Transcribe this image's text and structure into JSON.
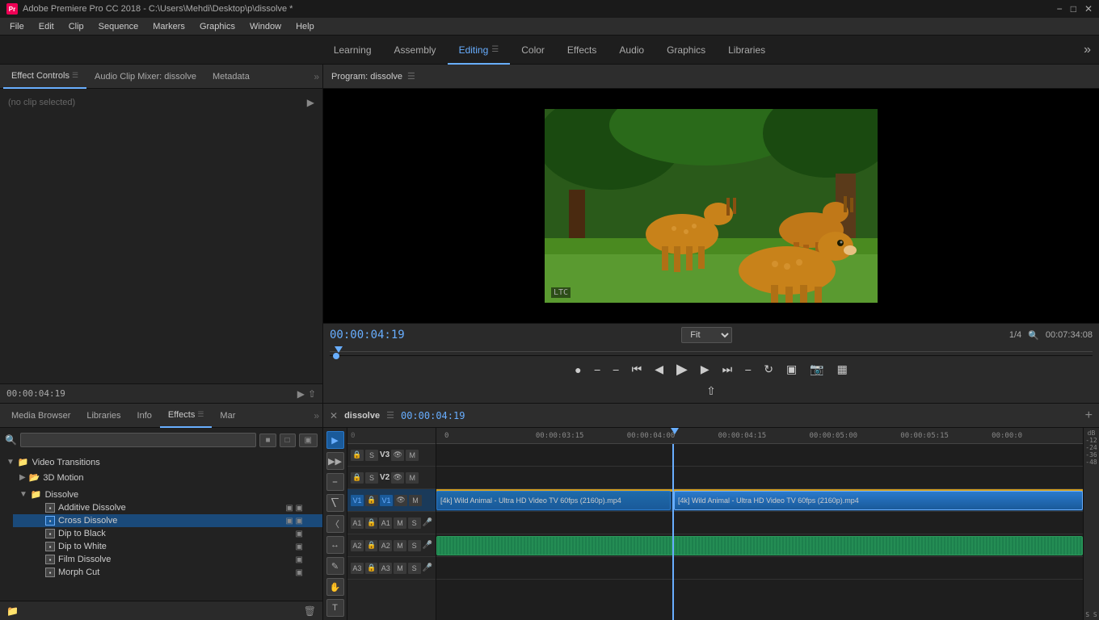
{
  "titleBar": {
    "appName": "Adobe Premiere Pro CC 2018 - C:\\Users\\Mehdi\\Desktop\\p\\dissolve *",
    "appIconLabel": "Pr",
    "controls": [
      "minimize",
      "maximize",
      "close"
    ]
  },
  "menuBar": {
    "items": [
      "File",
      "Edit",
      "Clip",
      "Sequence",
      "Markers",
      "Graphics",
      "Window",
      "Help"
    ]
  },
  "topNav": {
    "items": [
      {
        "label": "Learning",
        "active": false
      },
      {
        "label": "Assembly",
        "active": false
      },
      {
        "label": "Editing",
        "active": true
      },
      {
        "label": "Color",
        "active": false
      },
      {
        "label": "Effects",
        "active": false
      },
      {
        "label": "Audio",
        "active": false
      },
      {
        "label": "Graphics",
        "active": false
      },
      {
        "label": "Libraries",
        "active": false
      }
    ]
  },
  "effectControls": {
    "tabLabel": "Effect Controls",
    "audioMixerLabel": "Audio Clip Mixer: dissolve",
    "metadataLabel": "Metadata",
    "noClipLabel": "(no clip selected)",
    "timecode": "00:00:04:19"
  },
  "preview": {
    "title": "Program: dissolve",
    "time": "00:00:04:19",
    "fitLabel": "Fit",
    "zoomLabel": "1/4",
    "totalTime": "00:07:34:08",
    "timecodeOverlay": "LTC"
  },
  "effectsPanel": {
    "tabs": [
      {
        "label": "Media Browser"
      },
      {
        "label": "Libraries"
      },
      {
        "label": "Info"
      },
      {
        "label": "Effects",
        "active": true
      },
      {
        "label": "Mar"
      }
    ],
    "searchPlaceholder": "",
    "tree": {
      "rootFolder": {
        "name": "Video Transitions",
        "expanded": true,
        "children": [
          {
            "name": "3D Motion",
            "expanded": false,
            "type": "folder"
          },
          {
            "name": "Dissolve",
            "expanded": true,
            "type": "folder",
            "children": [
              {
                "name": "Additive Dissolve",
                "selected": false
              },
              {
                "name": "Cross Dissolve",
                "selected": true,
                "active": true
              },
              {
                "name": "Dip to Black",
                "selected": false
              },
              {
                "name": "Dip to White",
                "selected": false
              },
              {
                "name": "Film Dissolve",
                "selected": false
              },
              {
                "name": "Morph Cut",
                "selected": false
              }
            ]
          }
        ]
      }
    }
  },
  "timeline": {
    "title": "dissolve",
    "time": "00:00:04:19",
    "rulerTimes": [
      "0",
      "00:00:03:15",
      "00:00:04:00",
      "00:00:04:15",
      "00:00:05:00",
      "00:00:05:15",
      "00:00:0"
    ],
    "tracks": [
      {
        "name": "V3",
        "type": "video",
        "hasClip": false
      },
      {
        "name": "V2",
        "type": "video",
        "hasClip": false
      },
      {
        "name": "V1",
        "type": "video",
        "hasClip": true,
        "clipLabel": "[4k] Wild Animal - Ultra HD Video TV 60fps (2160p).mp4",
        "clipLabel2": "[4k] Wild Animal - Ultra HD Video TV 60fps (2160p).mp4"
      },
      {
        "name": "A1",
        "type": "audio",
        "hasClip": false
      },
      {
        "name": "A2",
        "type": "audio",
        "hasClip": true
      },
      {
        "name": "A3",
        "type": "audio",
        "hasClip": false
      }
    ],
    "volumeMarkers": [
      "dB",
      "-12",
      "-24",
      "-36",
      "-48",
      "S S"
    ]
  }
}
